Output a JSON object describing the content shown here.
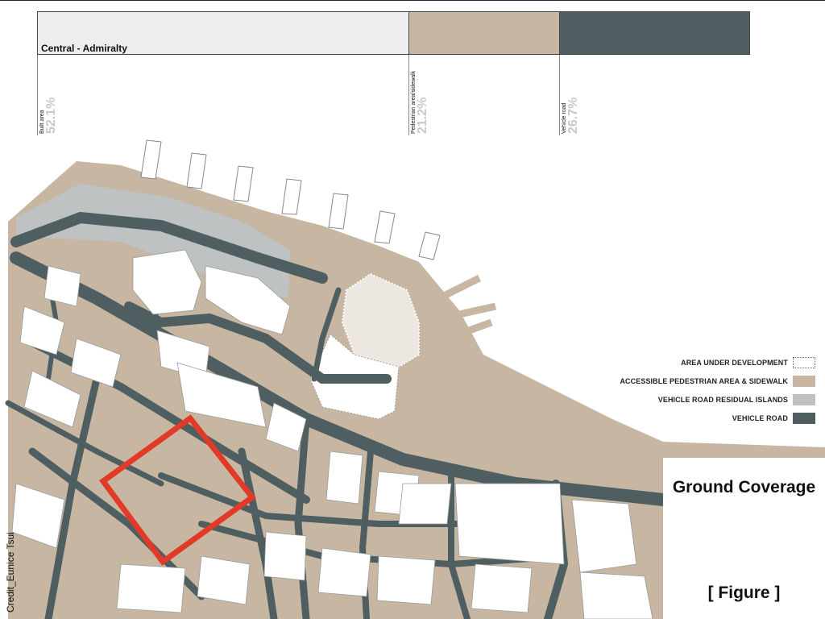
{
  "coverage_bar": {
    "title": "Central - Admiralty",
    "segments": [
      {
        "key": "built",
        "label": "Built area",
        "percent": "52.1%",
        "value": 52.1,
        "color": "#ededed"
      },
      {
        "key": "ped",
        "label": "Pedestrian area/sidewalk",
        "percent": "21.2%",
        "value": 21.2,
        "color": "#c7b7a2"
      },
      {
        "key": "road",
        "label": "Vehicle road",
        "percent": "26.7%",
        "value": 26.7,
        "color": "#4f5e60"
      }
    ]
  },
  "legend": [
    {
      "label": "AREA UNDER DEVELOPMENT",
      "color": "#ffffff",
      "style": "dotted-outline"
    },
    {
      "label": "ACCESSIBLE PEDESTRIAN AREA & SIDEWALK",
      "color": "#c7b7a2",
      "style": "fill"
    },
    {
      "label": "VEHICLE ROAD RESIDUAL ISLANDS",
      "color": "#bfc2c2",
      "style": "fill"
    },
    {
      "label": "VEHICLE ROAD",
      "color": "#4f5e60",
      "style": "fill"
    }
  ],
  "panel": {
    "title": "Ground Coverage",
    "figure_label": "[ Figure ]"
  },
  "credit": "Credit_Eunice Tsui",
  "colors": {
    "pedestrian": "#c7b7a2",
    "road": "#4f5e60",
    "residual": "#bfc2c2",
    "building": "#ffffff",
    "highlight": "#e23a28"
  },
  "map_features": [
    "pier-icon",
    "harbour-front",
    "highlight-frame"
  ]
}
